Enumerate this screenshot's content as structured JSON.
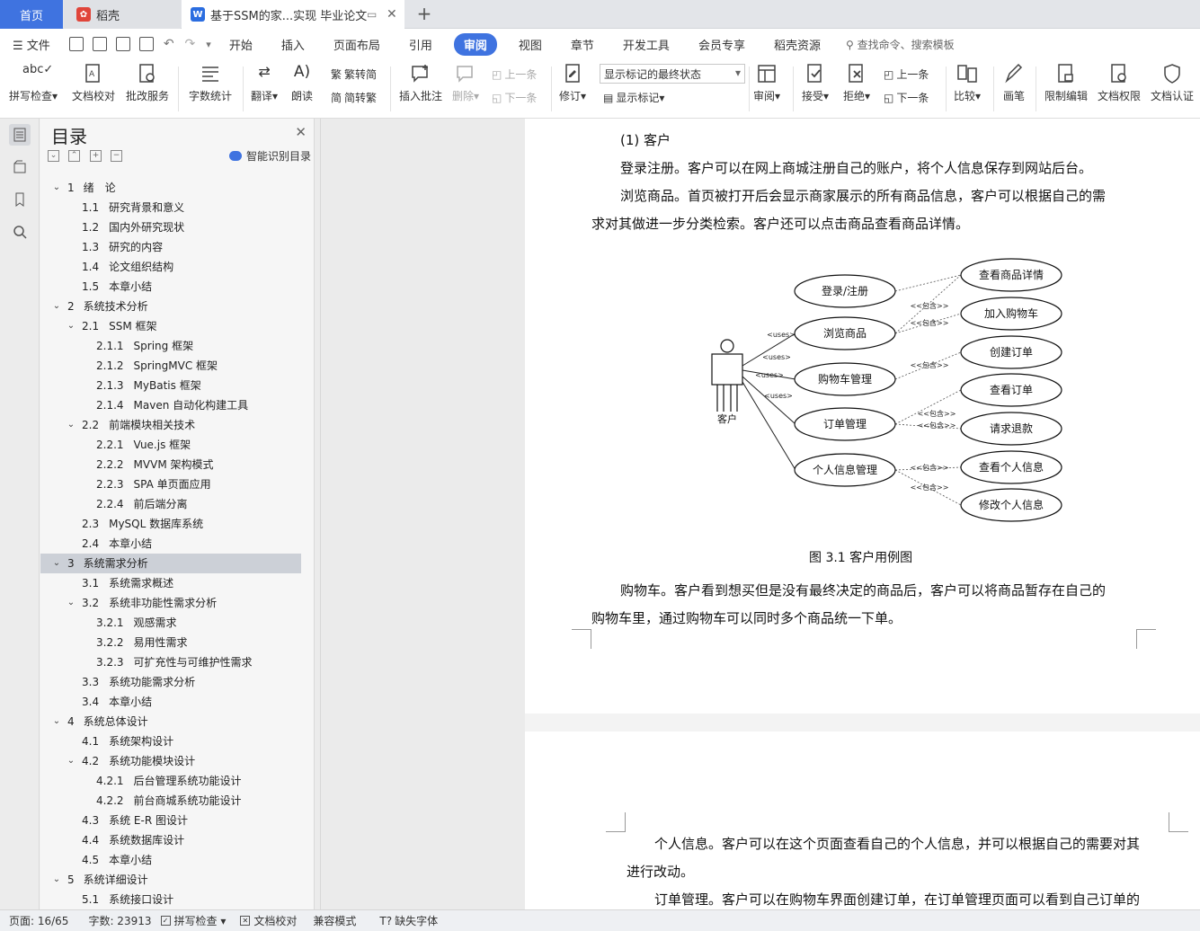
{
  "tabs": {
    "home": "首页",
    "daoke": "稻壳",
    "doc": "基于SSM的家...实现 毕业论文"
  },
  "menu": {
    "file": "文件",
    "items": [
      "开始",
      "插入",
      "页面布局",
      "引用",
      "审阅",
      "视图",
      "章节",
      "开发工具",
      "会员专享",
      "稻壳资源"
    ],
    "active_index": 4,
    "search": "查找命令、搜索模板"
  },
  "ribbon": {
    "spell": "拼写检查",
    "proof": "文档校对",
    "annotate": "批改服务",
    "wordcount": "字数统计",
    "translate": "翻译",
    "read": "朗读",
    "to_trad": "繁转简",
    "to_simp": "简转繁",
    "insert_comment": "插入批注",
    "delete": "删除",
    "prev_comment": "上一条",
    "next_comment": "下一条",
    "revise": "修订",
    "markup_state": "显示标记的最终状态",
    "show_markup": "显示标记",
    "review": "审阅",
    "accept": "接受",
    "reject": "拒绝",
    "prev": "上一条",
    "next": "下一条",
    "compare": "比较",
    "pen": "画笔",
    "restrict": "限制编辑",
    "permission": "文档权限",
    "certify": "文档认证"
  },
  "nav": {
    "title": "目录",
    "smart_toc": "智能识别目录",
    "items": [
      {
        "level": 1,
        "num": "1",
        "text": "绪　论",
        "arrow": "v"
      },
      {
        "level": 2,
        "num": "1.1",
        "text": "研究背景和意义"
      },
      {
        "level": 2,
        "num": "1.2",
        "text": "国内外研究现状"
      },
      {
        "level": 2,
        "num": "1.3",
        "text": "研究的内容"
      },
      {
        "level": 2,
        "num": "1.4",
        "text": "论文组织结构"
      },
      {
        "level": 2,
        "num": "1.5",
        "text": "本章小结"
      },
      {
        "level": 1,
        "num": "2",
        "text": "系统技术分析",
        "arrow": "v"
      },
      {
        "level": 2,
        "num": "2.1",
        "text": "SSM 框架",
        "arrow": "v"
      },
      {
        "level": 3,
        "num": "2.1.1",
        "text": "Spring 框架"
      },
      {
        "level": 3,
        "num": "2.1.2",
        "text": "SpringMVC 框架"
      },
      {
        "level": 3,
        "num": "2.1.3",
        "text": "MyBatis 框架"
      },
      {
        "level": 3,
        "num": "2.1.4",
        "text": "Maven 自动化构建工具"
      },
      {
        "level": 2,
        "num": "2.2",
        "text": "前端模块相关技术",
        "arrow": "v"
      },
      {
        "level": 3,
        "num": "2.2.1",
        "text": "Vue.js 框架"
      },
      {
        "level": 3,
        "num": "2.2.2",
        "text": "MVVM 架构模式"
      },
      {
        "level": 3,
        "num": "2.2.3",
        "text": "SPA 单页面应用"
      },
      {
        "level": 3,
        "num": "2.2.4",
        "text": "前后端分离"
      },
      {
        "level": 2,
        "num": "2.3",
        "text": "MySQL 数据库系统"
      },
      {
        "level": 2,
        "num": "2.4",
        "text": "本章小结"
      },
      {
        "level": 1,
        "num": "3",
        "text": "系统需求分析",
        "arrow": "v",
        "selected": true
      },
      {
        "level": 2,
        "num": "3.1",
        "text": "系统需求概述"
      },
      {
        "level": 2,
        "num": "3.2",
        "text": "系统非功能性需求分析",
        "arrow": "v"
      },
      {
        "level": 3,
        "num": "3.2.1",
        "text": "观感需求"
      },
      {
        "level": 3,
        "num": "3.2.2",
        "text": "易用性需求"
      },
      {
        "level": 3,
        "num": "3.2.3",
        "text": "可扩充性与可维护性需求"
      },
      {
        "level": 2,
        "num": "3.3",
        "text": "系统功能需求分析"
      },
      {
        "level": 2,
        "num": "3.4",
        "text": "本章小结"
      },
      {
        "level": 1,
        "num": "4",
        "text": "系统总体设计",
        "arrow": "v"
      },
      {
        "level": 2,
        "num": "4.1",
        "text": "系统架构设计"
      },
      {
        "level": 2,
        "num": "4.2",
        "text": "系统功能模块设计",
        "arrow": "v"
      },
      {
        "level": 3,
        "num": "4.2.1",
        "text": "后台管理系统功能设计"
      },
      {
        "level": 3,
        "num": "4.2.2",
        "text": "前台商城系统功能设计"
      },
      {
        "level": 2,
        "num": "4.3",
        "text": "系统 E-R 图设计"
      },
      {
        "level": 2,
        "num": "4.4",
        "text": "系统数据库设计"
      },
      {
        "level": 2,
        "num": "4.5",
        "text": "本章小结"
      },
      {
        "level": 1,
        "num": "5",
        "text": "系统详细设计",
        "arrow": "v"
      },
      {
        "level": 2,
        "num": "5.1",
        "text": "系统接口设计"
      }
    ]
  },
  "doc": {
    "heading": "(1) 客户",
    "p1": "登录注册。客户可以在网上商城注册自己的账户，将个人信息保存到网站后台。",
    "p2a": "浏览商品。首页被打开后会显示商家展示的所有商品信息，客户可以根据自己的需",
    "p2b": "求对其做进一步分类检索。客户还可以点击商品查看商品详情。",
    "caption": "图 3.1   客户用例图",
    "p3a": "购物车。客户看到想买但是没有最终决定的商品后，客户可以将商品暂存在自己的",
    "p3b": "购物车里，通过购物车可以同时多个商品统一下单。",
    "p4a": "个人信息。客户可以在这个页面查看自己的个人信息，并可以根据自己的需要对其",
    "p4b": "进行改动。",
    "p5a": "订单管理。客户可以在购物车界面创建订单，在订单管理页面可以看到自己订单的"
  },
  "diagram": {
    "actor": "客户",
    "uses": "<uses>",
    "include": "<<包含>>",
    "left_cases": [
      "登录/注册",
      "浏览商品",
      "购物车管理",
      "订单管理",
      "个人信息管理"
    ],
    "right_cases": [
      "查看商品详情",
      "加入购物车",
      "创建订单",
      "查看订单",
      "请求退款",
      "查看个人信息",
      "修改个人信息"
    ]
  },
  "status": {
    "page": "页面: 16/65",
    "words": "字数: 23913",
    "spell": "拼写检查",
    "proof": "文档校对",
    "compat": "兼容模式",
    "missing_font": "缺失字体"
  }
}
